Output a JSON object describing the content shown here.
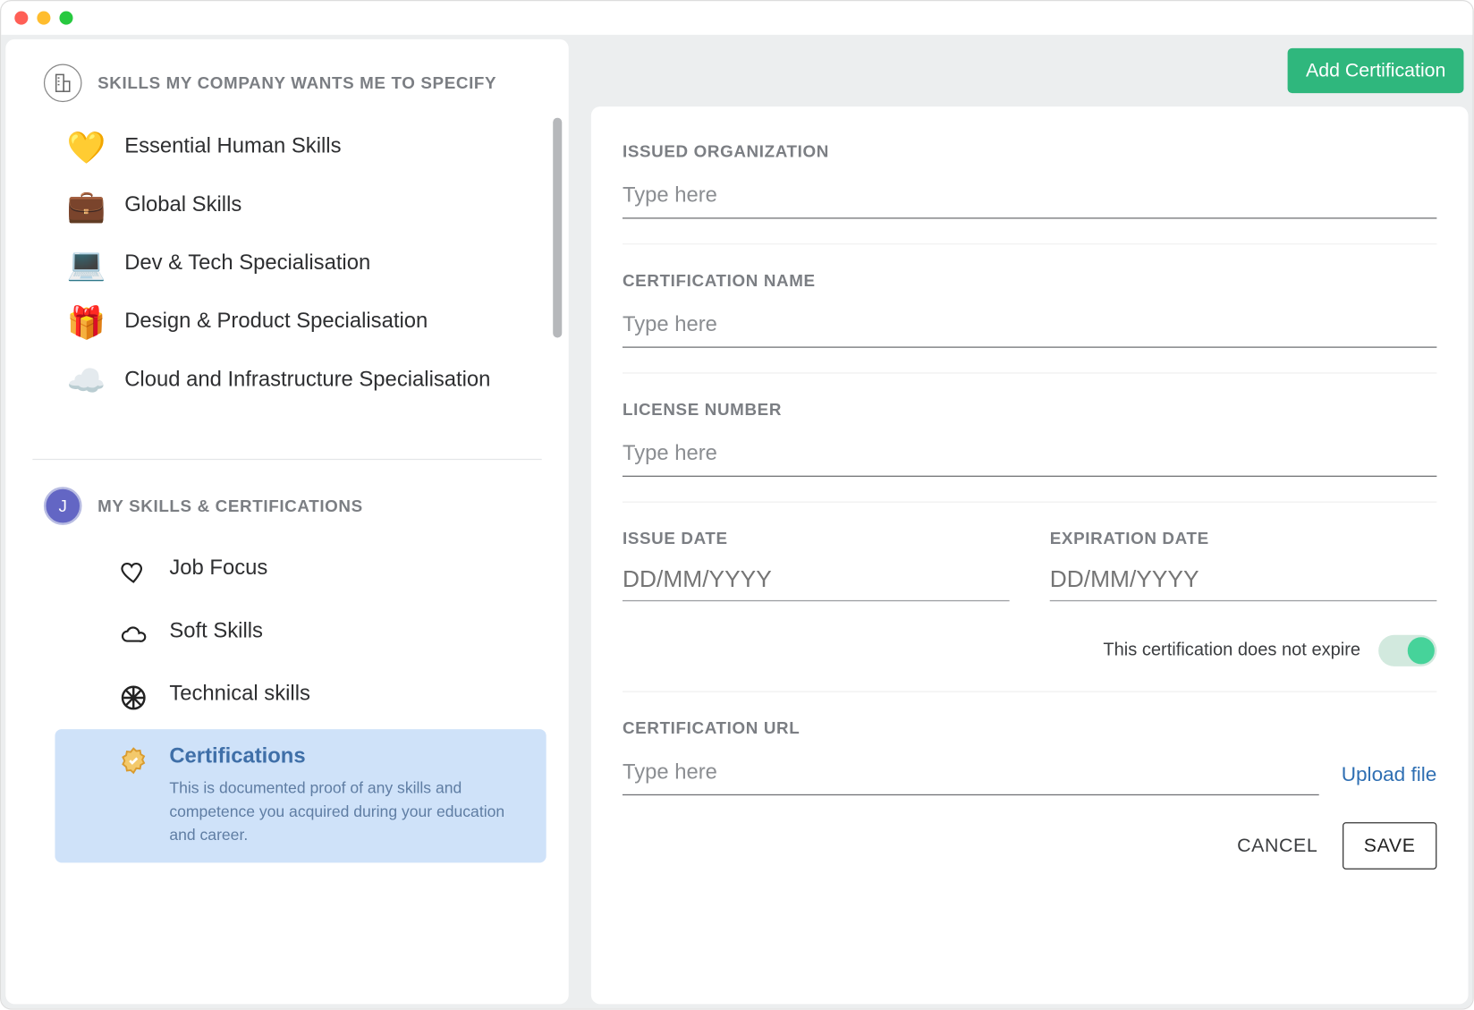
{
  "sidebar": {
    "company_section_title": "SKILLS MY COMPANY WANTS ME TO SPECIFY",
    "company_skills": [
      {
        "emoji": "💛",
        "label": "Essential Human Skills"
      },
      {
        "emoji": "💼",
        "label": "Global Skills"
      },
      {
        "emoji": "💻",
        "label": "Dev & Tech Specialisation"
      },
      {
        "emoji": "🎁",
        "label": "Design & Product Specialisation"
      },
      {
        "emoji": "☁️",
        "label": "Cloud and Infrastructure Specialisation"
      }
    ],
    "my_section_title": "MY SKILLS & CERTIFICATIONS",
    "avatar_letter": "J",
    "my_skills": [
      {
        "icon": "heart-outline",
        "label": "Job Focus"
      },
      {
        "icon": "cloud-outline",
        "label": "Soft Skills"
      },
      {
        "icon": "wheel",
        "label": "Technical skills"
      },
      {
        "icon": "badge",
        "label": "Certifications",
        "selected": true,
        "description": "This is documented proof of any skills and competence you acquired during your education and career."
      }
    ]
  },
  "main": {
    "add_button": "Add Certification",
    "fields": {
      "issued_org": {
        "label": "ISSUED ORGANIZATION",
        "placeholder": "Type here"
      },
      "cert_name": {
        "label": "CERTIFICATION NAME",
        "placeholder": "Type here"
      },
      "license": {
        "label": "LICENSE NUMBER",
        "placeholder": "Type here"
      },
      "issue_date": {
        "label": "ISSUE DATE",
        "placeholder": "DD/MM/YYYY"
      },
      "exp_date": {
        "label": "EXPIRATION DATE",
        "placeholder": "DD/MM/YYYY"
      },
      "no_expire": "This certification does not expire",
      "cert_url": {
        "label": "CERTIFICATION URL",
        "placeholder": "Type here"
      },
      "upload": "Upload file"
    },
    "actions": {
      "cancel": "CANCEL",
      "save": "SAVE"
    }
  }
}
